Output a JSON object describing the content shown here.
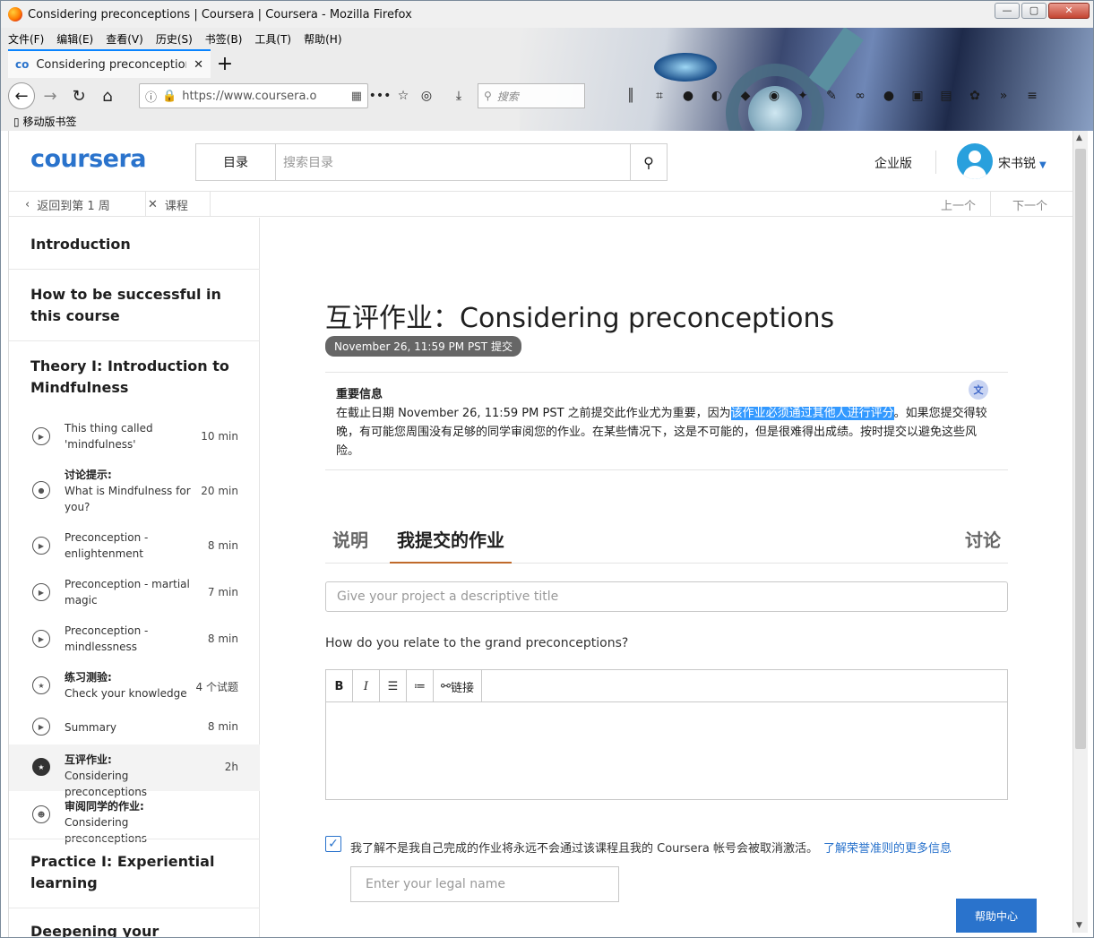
{
  "window": {
    "title": "Considering preconceptions | Coursera | Coursera - Mozilla Firefox",
    "min": "—",
    "max": "▢",
    "close": "✕"
  },
  "menu": [
    "文件(F)",
    "编辑(E)",
    "查看(V)",
    "历史(S)",
    "书签(B)",
    "工具(T)",
    "帮助(H)"
  ],
  "tab": {
    "title": "Considering preconceptions",
    "close": "✕",
    "new": "+"
  },
  "address": {
    "url": "https://www.coursera.o",
    "search_placeholder": "搜索"
  },
  "bookmarks": {
    "mobile": "移动版书签"
  },
  "header": {
    "logo": "coursera",
    "catalog": "目录",
    "search_placeholder": "搜索目录",
    "enterprise": "企业版",
    "user": "宋书锐"
  },
  "subnav": {
    "back": "返回到第 1 周",
    "course": "课程",
    "prev": "上一个",
    "next": "下一个"
  },
  "sidebar": {
    "sections": [
      "Introduction",
      "How to be successful in this course",
      "Theory I: Introduction to Mindfulness",
      "Practice I: Experiential learning",
      "Deepening your knowledge"
    ],
    "lessons": [
      {
        "label": "",
        "title": "This thing called 'mindfulness'",
        "duration": "10 min",
        "icon": "play-icon"
      },
      {
        "label": "讨论提示:",
        "title": "What is Mindfulness for you?",
        "duration": "20 min",
        "icon": "discussion-icon"
      },
      {
        "label": "",
        "title": "Preconception - enlightenment",
        "duration": "8 min",
        "icon": "play-icon"
      },
      {
        "label": "",
        "title": "Preconception - martial magic",
        "duration": "7 min",
        "icon": "play-icon"
      },
      {
        "label": "",
        "title": "Preconception - mindlessness",
        "duration": "8 min",
        "icon": "play-icon"
      },
      {
        "label": "练习测验:",
        "title": "Check your knowledge",
        "duration": "4 个试题",
        "icon": "quiz-icon"
      },
      {
        "label": "",
        "title": "Summary",
        "duration": "8 min",
        "icon": "play-icon"
      },
      {
        "label": "互评作业:",
        "title": "Considering preconceptions",
        "duration": "2h",
        "icon": "assignment-icon"
      },
      {
        "label": "审阅同学的作业:",
        "title": "Considering preconceptions",
        "duration": "",
        "icon": "review-icon"
      }
    ]
  },
  "main": {
    "title": "互评作业：Considering preconceptions",
    "due": "November 26, 11:59 PM PST 提交",
    "notice_title": "重要信息",
    "notice_pre": "在截止日期 November 26, 11:59 PM PST 之前提交此作业尤为重要，因为",
    "notice_hl": "该作业必须通过其他人进行评分",
    "notice_post": "。如果您提交得较晚，有可能您周围没有足够的同学审阅您的作业。在某些情况下，这是不可能的，但是很难得出成绩。按时提交以避免这些风险。",
    "tabs": {
      "instructions": "说明",
      "my_submission": "我提交的作业",
      "discussion": "讨论"
    },
    "title_placeholder": "Give your project a descriptive title",
    "question": "How do you relate to the grand preconceptions?",
    "toolbar": {
      "bold": "B",
      "italic": "I",
      "link": "链接"
    },
    "honor_text": "我了解不是我自己完成的作业将永远不会通过该课程且我的 Coursera 帐号会被取消激活。",
    "honor_link": "了解荣誉准则的更多信息",
    "legal_placeholder": "Enter your legal name",
    "help": "帮助中心"
  }
}
